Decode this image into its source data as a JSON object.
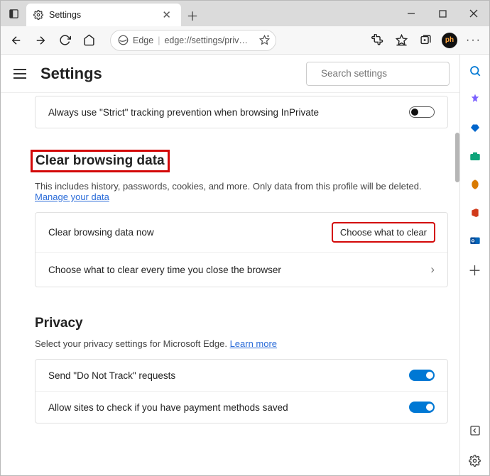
{
  "tab": {
    "title": "Settings"
  },
  "toolbar": {
    "edge_label": "Edge",
    "url_display": "edge://settings/priv…",
    "avatar_initials": "ph"
  },
  "header": {
    "title": "Settings",
    "search_placeholder": "Search settings"
  },
  "tracking": {
    "row_label": "Always use \"Strict\" tracking prevention when browsing InPrivate"
  },
  "clear": {
    "heading": "Clear browsing data",
    "description_pre": "This includes history, passwords, cookies, and more. Only data from this profile will be deleted. ",
    "manage_link": "Manage your data",
    "now_label": "Clear browsing data now",
    "choose_button": "Choose what to clear",
    "every_time_label": "Choose what to clear every time you close the browser"
  },
  "privacy": {
    "heading": "Privacy",
    "description_pre": "Select your privacy settings for Microsoft Edge. ",
    "learn_link": "Learn more",
    "dnt_label": "Send \"Do Not Track\" requests",
    "payment_label": "Allow sites to check if you have payment methods saved"
  }
}
